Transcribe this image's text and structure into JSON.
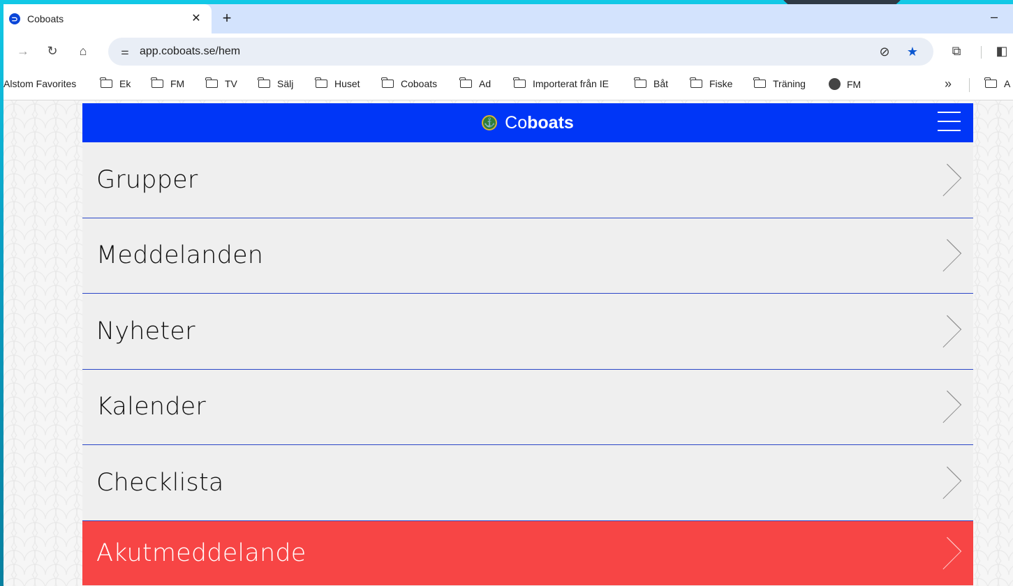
{
  "browser": {
    "tab_title": "Coboats",
    "tab_close": "✕",
    "new_tab": "+",
    "minimize": "–",
    "url": "app.coboats.se/hem",
    "bookmarks": [
      {
        "label": "Alstom Favorites",
        "icon": "none"
      },
      {
        "label": "Ek",
        "icon": "folder-icon"
      },
      {
        "label": "FM",
        "icon": "folder-icon"
      },
      {
        "label": "TV",
        "icon": "folder-icon"
      },
      {
        "label": "Sälj",
        "icon": "folder-icon"
      },
      {
        "label": "Huset",
        "icon": "folder-icon"
      },
      {
        "label": "Coboats",
        "icon": "folder-icon"
      },
      {
        "label": "Ad",
        "icon": "folder-icon"
      },
      {
        "label": "Importerat från IE",
        "icon": "folder-icon"
      },
      {
        "label": "Båt",
        "icon": "folder-icon"
      },
      {
        "label": "Fiske",
        "icon": "folder-icon"
      },
      {
        "label": "Träning",
        "icon": "folder-icon"
      },
      {
        "label": "FM",
        "icon": "globe-icon"
      }
    ],
    "bookmarks_more": "»",
    "bookmark_overflow": "A"
  },
  "app": {
    "brand_prefix": "Co",
    "brand_bold": "boats",
    "header_color": "#0036f7",
    "alert_color": "#f74545",
    "menu": [
      {
        "label": "Grupper"
      },
      {
        "label": "Meddelanden"
      },
      {
        "label": "Nyheter"
      },
      {
        "label": "Kalender"
      },
      {
        "label": "Checklista"
      }
    ],
    "alert_item": {
      "label": "Akutmeddelande"
    }
  }
}
